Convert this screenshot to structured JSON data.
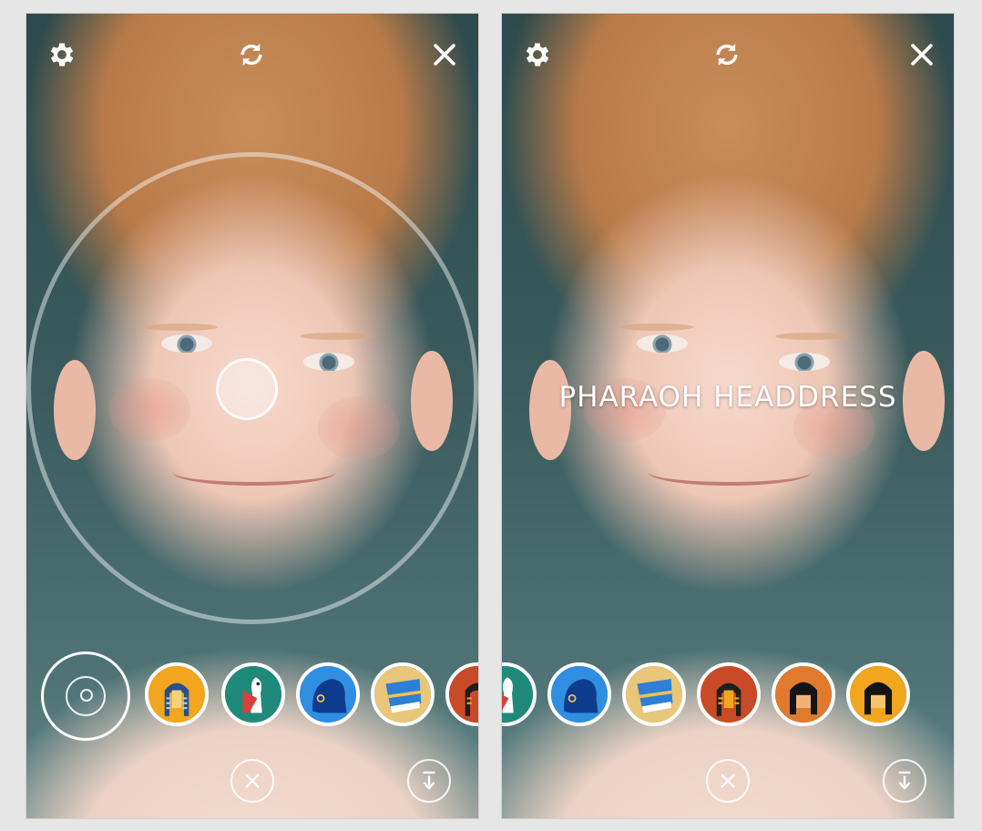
{
  "screens": [
    {
      "id": "left",
      "mode": "camera-focus",
      "icons": {
        "settings": "gear-icon",
        "flip": "camera-flip-icon",
        "close": "close-icon",
        "cancel": "cancel-circle-icon",
        "download": "download-icon"
      }
    },
    {
      "id": "right",
      "mode": "filter-preview",
      "caption": "PHARAOH HEADDRESS",
      "icons": {
        "settings": "gear-icon",
        "flip": "camera-flip-icon",
        "close": "close-icon",
        "cancel": "cancel-circle-icon",
        "download": "download-icon"
      }
    }
  ],
  "filters_left": [
    {
      "name": "pharaoh-headdress",
      "bg": "#f2a51e"
    },
    {
      "name": "white-bird",
      "bg": "#1f8a7a"
    },
    {
      "name": "blue-crown",
      "bg": "#2f8ee0"
    },
    {
      "name": "nefertiti-crown",
      "bg": "#e8c67a"
    },
    {
      "name": "red-pharaoh",
      "bg": "#c94a26"
    }
  ],
  "filters_right": [
    {
      "name": "white-bird",
      "bg": "#1f8a7a"
    },
    {
      "name": "blue-crown",
      "bg": "#2f8ee0"
    },
    {
      "name": "nefertiti-crown",
      "bg": "#e8c67a"
    },
    {
      "name": "red-pharaoh",
      "bg": "#c94a26"
    },
    {
      "name": "black-wig-orange",
      "bg": "#e07b2e"
    },
    {
      "name": "black-wig-yellow",
      "bg": "#f2a51e"
    }
  ]
}
